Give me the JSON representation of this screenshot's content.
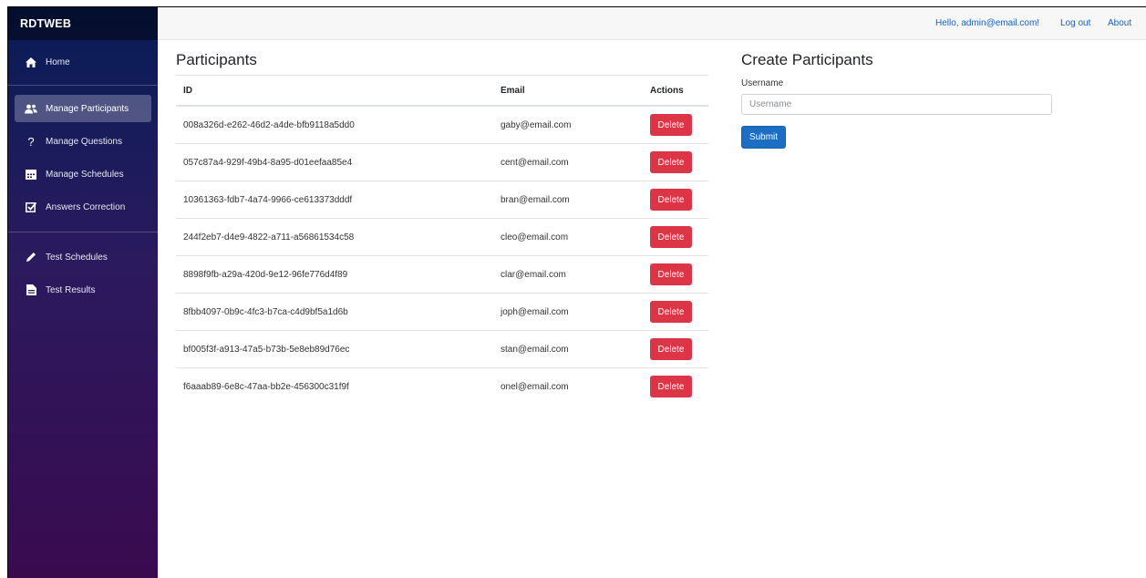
{
  "app": {
    "brand": "RDTWEB"
  },
  "topbar": {
    "greeting": "Hello, admin@email.com!",
    "logout": "Log out",
    "about": "About"
  },
  "sidebar": {
    "group1": [
      {
        "label": "Home",
        "icon": "home-icon"
      }
    ],
    "group2": [
      {
        "label": "Manage Participants",
        "icon": "users-icon",
        "active": true
      },
      {
        "label": "Manage Questions",
        "icon": "question-icon"
      },
      {
        "label": "Manage Schedules",
        "icon": "calendar-icon"
      },
      {
        "label": "Answers Correction",
        "icon": "check-square-icon"
      }
    ],
    "group3": [
      {
        "label": "Test Schedules",
        "icon": "pencil-icon"
      },
      {
        "label": "Test Results",
        "icon": "file-icon"
      }
    ]
  },
  "participants": {
    "title": "Participants",
    "columns": {
      "id": "ID",
      "email": "Email",
      "actions": "Actions"
    },
    "delete_label": "Delete",
    "rows": [
      {
        "id": "008a326d-e262-46d2-a4de-bfb9118a5dd0",
        "email": "gaby@email.com"
      },
      {
        "id": "057c87a4-929f-49b4-8a95-d01eefaa85e4",
        "email": "cent@email.com"
      },
      {
        "id": "10361363-fdb7-4a74-9966-ce613373dddf",
        "email": "bran@email.com"
      },
      {
        "id": "244f2eb7-d4e9-4822-a711-a56861534c58",
        "email": "cleo@email.com"
      },
      {
        "id": "8898f9fb-a29a-420d-9e12-96fe776d4f89",
        "email": "clar@email.com"
      },
      {
        "id": "8fbb4097-0b9c-4fc3-b7ca-c4d9bf5a1d6b",
        "email": "joph@email.com"
      },
      {
        "id": "bf005f3f-a913-47a5-b73b-5e8eb89d76ec",
        "email": "stan@email.com"
      },
      {
        "id": "f6aaab89-6e8c-47aa-bb2e-456300c31f9f",
        "email": "onel@email.com"
      }
    ]
  },
  "create": {
    "title": "Create Participants",
    "username_label": "Username",
    "username_placeholder": "Username",
    "username_value": "",
    "submit_label": "Submit"
  },
  "colors": {
    "delete": "#dc3545",
    "submit": "#1b6ec2",
    "link": "#1860c0"
  }
}
